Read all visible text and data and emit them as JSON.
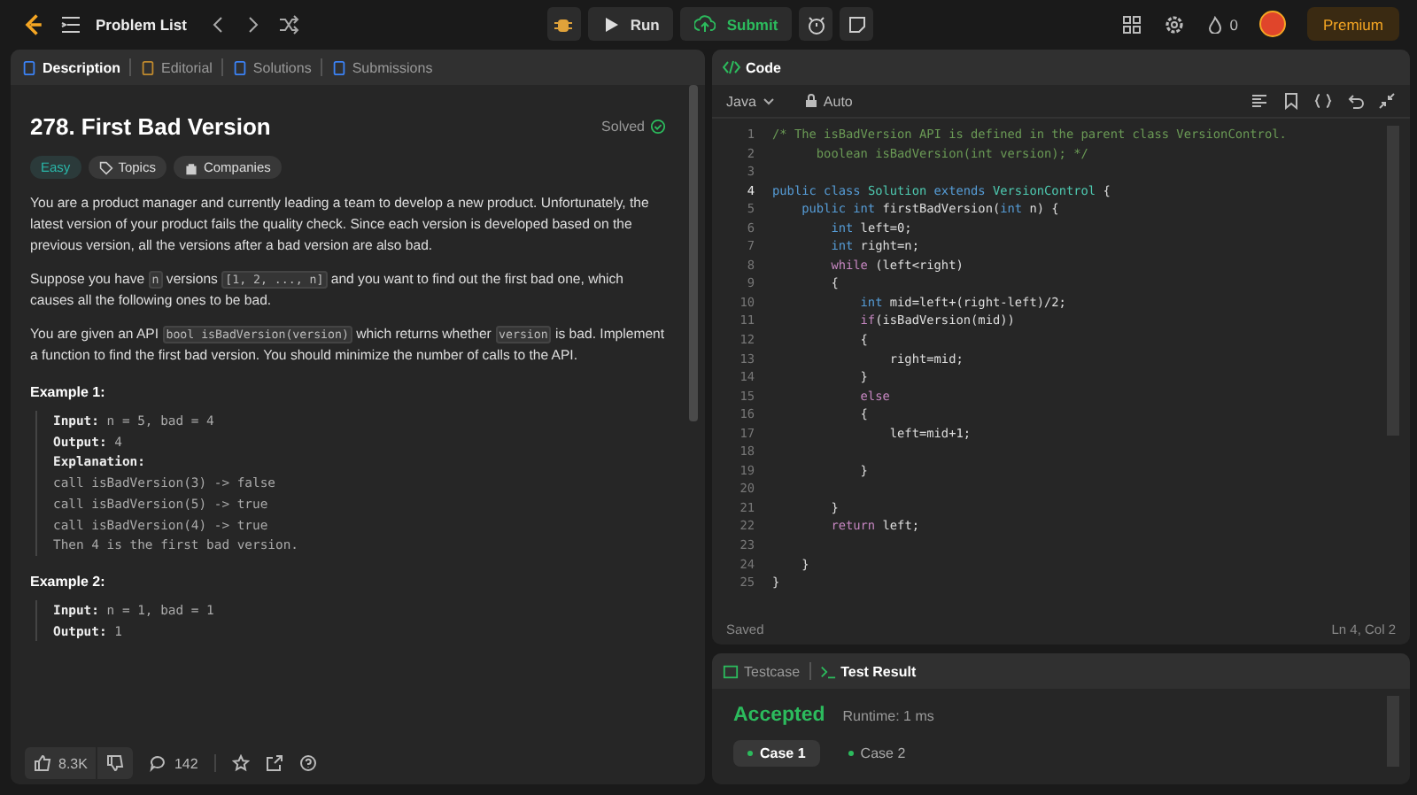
{
  "topbar": {
    "title": "Problem List",
    "run": "Run",
    "submit": "Submit",
    "streak": "0",
    "premium": "Premium"
  },
  "description_panel": {
    "tabs": [
      {
        "label": "Description",
        "selected": true
      },
      {
        "label": "Editorial",
        "selected": false
      },
      {
        "label": "Solutions",
        "selected": false
      },
      {
        "label": "Submissions",
        "selected": false
      }
    ],
    "title": "278. First Bad Version",
    "status": "Solved",
    "difficulty": "Easy",
    "tags": [
      "Topics",
      "Companies"
    ],
    "paragraphs": [
      [
        {
          "kind": "text",
          "t": "You are a product manager and currently leading a team to develop a new product. Unfortunately, the latest version of your product fails the quality check. Since each version is developed based on the previous version, all the versions after a bad version are also bad."
        }
      ],
      [
        {
          "kind": "text",
          "t": "Suppose you have "
        },
        {
          "kind": "code",
          "t": "n"
        },
        {
          "kind": "text",
          "t": " versions "
        },
        {
          "kind": "code",
          "t": "[1, 2, ..., n]"
        },
        {
          "kind": "text",
          "t": " and you want to find out the first bad one, which causes all the following ones to be bad."
        }
      ],
      [
        {
          "kind": "text",
          "t": "You are given an API "
        },
        {
          "kind": "code",
          "t": "bool isBadVersion(version)"
        },
        {
          "kind": "text",
          "t": " which returns whether "
        },
        {
          "kind": "code",
          "t": "version"
        },
        {
          "kind": "text",
          "t": " is bad. Implement a function to find the first bad version. You should minimize the number of calls to the API."
        }
      ]
    ],
    "examples": [
      {
        "title": "Example 1:",
        "lines": [
          {
            "kind": "field",
            "label": "Input:",
            "value": "n = 5, bad = 4"
          },
          {
            "kind": "field",
            "label": "Output:",
            "value": "4"
          },
          {
            "kind": "heading",
            "label": "Explanation:"
          },
          {
            "kind": "plain",
            "value": "call isBadVersion(3) -> false"
          },
          {
            "kind": "plain",
            "value": "call isBadVersion(5) -> true"
          },
          {
            "kind": "plain",
            "value": "call isBadVersion(4) -> true"
          },
          {
            "kind": "plain",
            "value": "Then 4 is the first bad version."
          }
        ]
      },
      {
        "title": "Example 2:",
        "lines": [
          {
            "kind": "field",
            "label": "Input:",
            "value": "n = 1, bad = 1"
          },
          {
            "kind": "field",
            "label": "Output:",
            "value": "1"
          }
        ]
      }
    ],
    "footer": {
      "likes": "8.3K",
      "comments": "142"
    }
  },
  "code_panel": {
    "title": "Code",
    "language": "Java",
    "mode": "Auto",
    "saved": "Saved",
    "cursor": "Ln 4, Col 2",
    "lines": [
      {
        "n": "1",
        "active": false,
        "tokens": [
          {
            "kind": "comment",
            "t": "/* The isBadVersion API is defined in the parent class VersionControl."
          }
        ]
      },
      {
        "n": "2",
        "active": false,
        "tokens": [
          {
            "kind": "comment",
            "t": "      boolean isBadVersion(int version); */"
          }
        ]
      },
      {
        "n": "3",
        "active": false
      },
      {
        "n": "4",
        "active": true,
        "tokens": [
          {
            "kind": "kw",
            "t": "public class "
          },
          {
            "kind": "type",
            "t": "Solution "
          },
          {
            "kind": "kw",
            "t": "extends "
          },
          {
            "kind": "type",
            "t": "VersionControl"
          },
          {
            "kind": "plain",
            "t": " {"
          }
        ]
      },
      {
        "n": "5",
        "active": false,
        "tokens": [
          {
            "kind": "kw",
            "t": "    public int "
          },
          {
            "kind": "plain",
            "t": "firstBadVersion("
          },
          {
            "kind": "kw",
            "t": "int"
          },
          {
            "kind": "plain",
            "t": " n) {"
          }
        ]
      },
      {
        "n": "6",
        "active": false,
        "tokens": [
          {
            "kind": "kw",
            "t": "        int"
          },
          {
            "kind": "plain",
            "t": " left=0;"
          }
        ]
      },
      {
        "n": "7",
        "active": false,
        "tokens": [
          {
            "kind": "kw",
            "t": "        int"
          },
          {
            "kind": "plain",
            "t": " right=n;"
          }
        ]
      },
      {
        "n": "8",
        "active": false,
        "tokens": [
          {
            "kind": "ctrl",
            "t": "        while"
          },
          {
            "kind": "plain",
            "t": " (left<right)"
          }
        ]
      },
      {
        "n": "9",
        "active": false,
        "tokens": [
          {
            "kind": "plain",
            "t": "        {"
          }
        ]
      },
      {
        "n": "10",
        "active": false,
        "tokens": [
          {
            "kind": "kw",
            "t": "            int"
          },
          {
            "kind": "plain",
            "t": " mid=left+(right-left)/2;"
          }
        ]
      },
      {
        "n": "11",
        "active": false,
        "tokens": [
          {
            "kind": "ctrl",
            "t": "            if"
          },
          {
            "kind": "plain",
            "t": "(isBadVersion(mid))"
          }
        ]
      },
      {
        "n": "12",
        "active": false,
        "tokens": [
          {
            "kind": "plain",
            "t": "            {"
          }
        ]
      },
      {
        "n": "13",
        "active": false,
        "tokens": [
          {
            "kind": "plain",
            "t": "                right=mid;"
          }
        ]
      },
      {
        "n": "14",
        "active": false,
        "tokens": [
          {
            "kind": "plain",
            "t": "            }"
          }
        ]
      },
      {
        "n": "15",
        "active": false,
        "tokens": [
          {
            "kind": "ctrl",
            "t": "            else"
          }
        ]
      },
      {
        "n": "16",
        "active": false,
        "tokens": [
          {
            "kind": "plain",
            "t": "            {"
          }
        ]
      },
      {
        "n": "17",
        "active": false,
        "tokens": [
          {
            "kind": "plain",
            "t": "                left=mid+1;"
          }
        ]
      },
      {
        "n": "18",
        "active": false
      },
      {
        "n": "19",
        "active": false,
        "tokens": [
          {
            "kind": "plain",
            "t": "            }"
          }
        ]
      },
      {
        "n": "20",
        "active": false
      },
      {
        "n": "21",
        "active": false,
        "tokens": [
          {
            "kind": "plain",
            "t": "        }"
          }
        ]
      },
      {
        "n": "22",
        "active": false,
        "tokens": [
          {
            "kind": "ctrl",
            "t": "        return"
          },
          {
            "kind": "plain",
            "t": " left;"
          }
        ]
      },
      {
        "n": "23",
        "active": false
      },
      {
        "n": "24",
        "active": false,
        "tokens": [
          {
            "kind": "plain",
            "t": "    }"
          }
        ]
      },
      {
        "n": "25",
        "active": false,
        "tokens": [
          {
            "kind": "plain",
            "t": "}"
          }
        ]
      }
    ]
  },
  "result_panel": {
    "tabs": [
      {
        "label": "Testcase",
        "selected": false
      },
      {
        "label": "Test Result",
        "selected": true
      }
    ],
    "verdict": "Accepted",
    "runtime": "Runtime: 1 ms",
    "cases": [
      {
        "label": "Case 1",
        "selected": true
      },
      {
        "label": "Case 2",
        "selected": false
      }
    ]
  }
}
